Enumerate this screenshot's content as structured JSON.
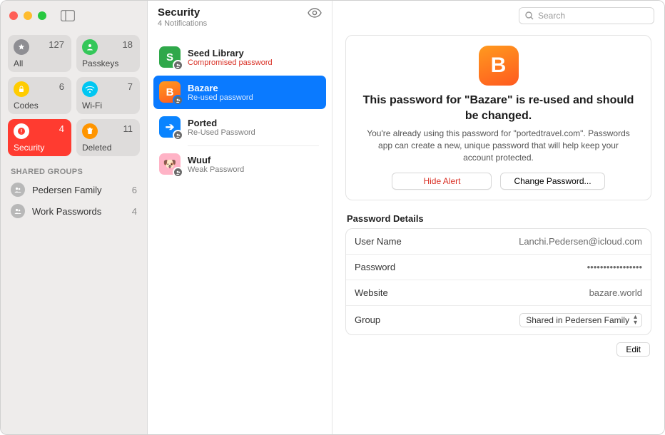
{
  "colors": {
    "accent": "#0a7aff",
    "danger": "#ff3b30",
    "warn_text": "#d93025"
  },
  "sidebar": {
    "tiles": [
      {
        "id": "all",
        "label": "All",
        "count": 127,
        "icon": "star-icon",
        "bg": "#8e8e93"
      },
      {
        "id": "passkeys",
        "label": "Passkeys",
        "count": 18,
        "icon": "person-icon",
        "bg": "#34c759"
      },
      {
        "id": "codes",
        "label": "Codes",
        "count": 6,
        "icon": "lock-icon",
        "bg": "#ffcc00"
      },
      {
        "id": "wifi",
        "label": "Wi-Fi",
        "count": 7,
        "icon": "wifi-icon",
        "bg": "#00c7f2"
      },
      {
        "id": "security",
        "label": "Security",
        "count": 4,
        "icon": "alert-icon",
        "bg": "#ff3b30",
        "active": true
      },
      {
        "id": "deleted",
        "label": "Deleted",
        "count": 11,
        "icon": "trash-icon",
        "bg": "#ff9500"
      }
    ],
    "shared_groups_header": "SHARED GROUPS",
    "groups": [
      {
        "label": "Pedersen Family",
        "count": 6
      },
      {
        "label": "Work Passwords",
        "count": 4
      }
    ]
  },
  "mid": {
    "title": "Security",
    "subtitle": "4 Notifications",
    "items": [
      {
        "name": "Seed Library",
        "reason": "Compromised password",
        "reason_warn": true,
        "icon_bg": "#2fa84a",
        "icon_text": "S"
      },
      {
        "name": "Bazare",
        "reason": "Re-used password",
        "reason_warn": false,
        "icon_bg": "linear-gradient(160deg,#ff9a1f,#ff5a1f)",
        "icon_text": "B",
        "selected": true
      },
      {
        "name": "Ported",
        "reason": "Re-Used Password",
        "reason_warn": false,
        "icon_bg": "#0a84ff",
        "icon_text": "➔"
      },
      {
        "name": "Wuuf",
        "reason": "Weak Password",
        "reason_warn": false,
        "icon_bg": "#ffb3c6",
        "icon_text": "🐶"
      }
    ]
  },
  "search": {
    "placeholder": "Search"
  },
  "detail": {
    "icon_text": "B",
    "heading": "This password for \"Bazare\" is re-used and should be changed.",
    "body": "You're already using this password for \"portedtravel.com\". Passwords app can create a new, unique password that will help keep your account protected.",
    "hide_label": "Hide Alert",
    "change_label": "Change Password...",
    "details_title": "Password Details",
    "rows": {
      "username_label": "User Name",
      "username_value": "Lanchi.Pedersen@icloud.com",
      "password_label": "Password",
      "password_value": "•••••••••••••••••",
      "website_label": "Website",
      "website_value": "bazare.world",
      "group_label": "Group",
      "group_value": "Shared in Pedersen Family"
    },
    "edit_label": "Edit"
  }
}
